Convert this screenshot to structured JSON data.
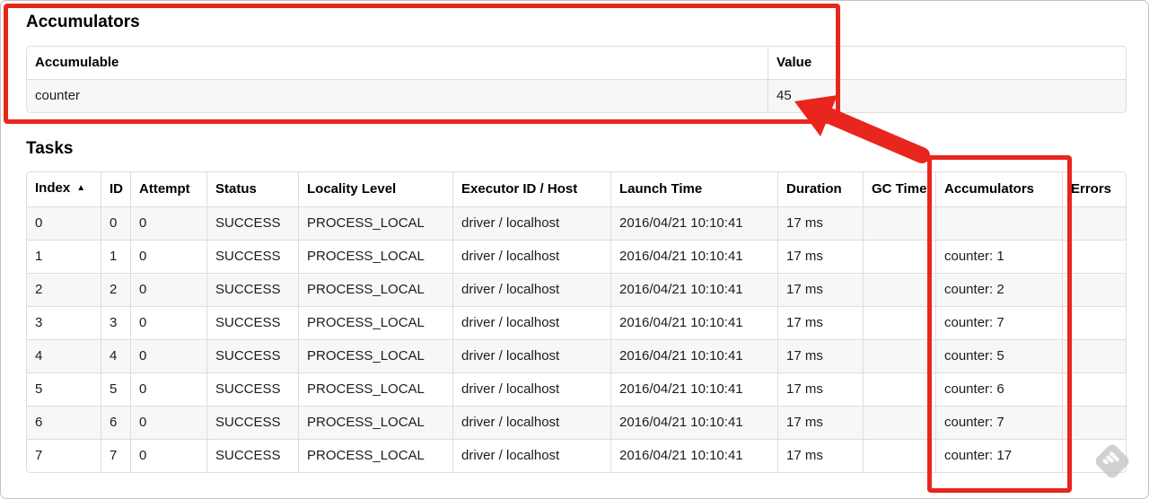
{
  "annotations": {
    "highlight_color": "#e9261d"
  },
  "accumulators_section": {
    "title": "Accumulators",
    "table": {
      "headers": [
        "Accumulable",
        "Value"
      ],
      "rows": [
        [
          "counter",
          "45"
        ]
      ]
    }
  },
  "tasks_section": {
    "title": "Tasks",
    "table": {
      "headers": [
        "Index",
        "ID",
        "Attempt",
        "Status",
        "Locality Level",
        "Executor ID / Host",
        "Launch Time",
        "Duration",
        "GC Time",
        "Accumulators",
        "Errors"
      ],
      "sorted_column": "Index",
      "sort_indicator": "▲",
      "rows": [
        [
          "0",
          "0",
          "0",
          "SUCCESS",
          "PROCESS_LOCAL",
          "driver / localhost",
          "2016/04/21 10:10:41",
          "17 ms",
          "",
          "",
          ""
        ],
        [
          "1",
          "1",
          "0",
          "SUCCESS",
          "PROCESS_LOCAL",
          "driver / localhost",
          "2016/04/21 10:10:41",
          "17 ms",
          "",
          "counter: 1",
          ""
        ],
        [
          "2",
          "2",
          "0",
          "SUCCESS",
          "PROCESS_LOCAL",
          "driver / localhost",
          "2016/04/21 10:10:41",
          "17 ms",
          "",
          "counter: 2",
          ""
        ],
        [
          "3",
          "3",
          "0",
          "SUCCESS",
          "PROCESS_LOCAL",
          "driver / localhost",
          "2016/04/21 10:10:41",
          "17 ms",
          "",
          "counter: 7",
          ""
        ],
        [
          "4",
          "4",
          "0",
          "SUCCESS",
          "PROCESS_LOCAL",
          "driver / localhost",
          "2016/04/21 10:10:41",
          "17 ms",
          "",
          "counter: 5",
          ""
        ],
        [
          "5",
          "5",
          "0",
          "SUCCESS",
          "PROCESS_LOCAL",
          "driver / localhost",
          "2016/04/21 10:10:41",
          "17 ms",
          "",
          "counter: 6",
          ""
        ],
        [
          "6",
          "6",
          "0",
          "SUCCESS",
          "PROCESS_LOCAL",
          "driver / localhost",
          "2016/04/21 10:10:41",
          "17 ms",
          "",
          "counter: 7",
          ""
        ],
        [
          "7",
          "7",
          "0",
          "SUCCESS",
          "PROCESS_LOCAL",
          "driver / localhost",
          "2016/04/21 10:10:41",
          "17 ms",
          "",
          "counter: 17",
          ""
        ]
      ]
    }
  }
}
